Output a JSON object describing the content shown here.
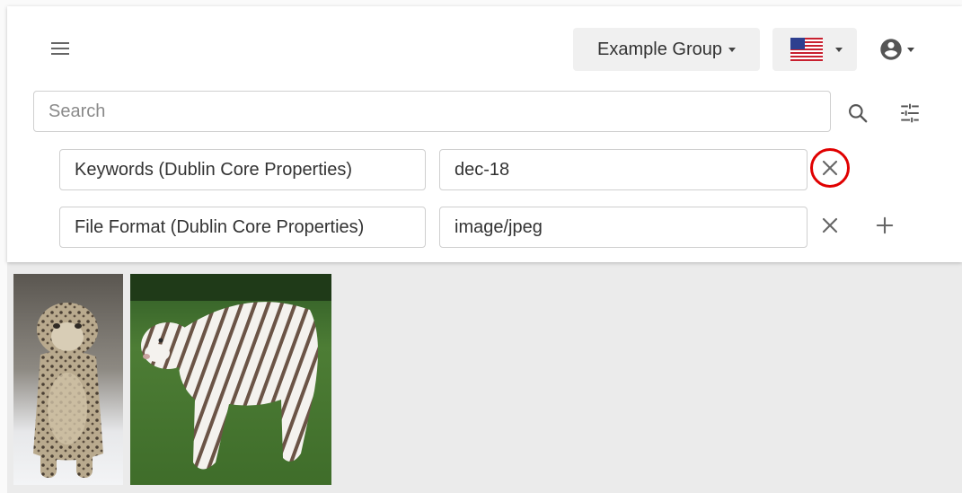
{
  "header": {
    "group_label": "Example Group",
    "language_flag": "us-flag-icon",
    "account_icon": "account-circle-icon"
  },
  "search": {
    "placeholder": "Search",
    "value": ""
  },
  "filters": [
    {
      "field": "Keywords (Dublin Core Properties)",
      "value": "dec-18"
    },
    {
      "field": "File Format (Dublin Core Properties)",
      "value": "image/jpeg"
    }
  ],
  "icons": {
    "menu": "hamburger-menu-icon",
    "search": "search-icon",
    "advanced": "tune-icon",
    "remove": "close-icon",
    "add": "plus-icon"
  },
  "results": [
    {
      "subject": "snow leopard"
    },
    {
      "subject": "white tiger"
    }
  ],
  "colors": {
    "highlight": "#e00000",
    "button_bg": "#f0f0f0",
    "results_bg": "#ebebeb"
  }
}
